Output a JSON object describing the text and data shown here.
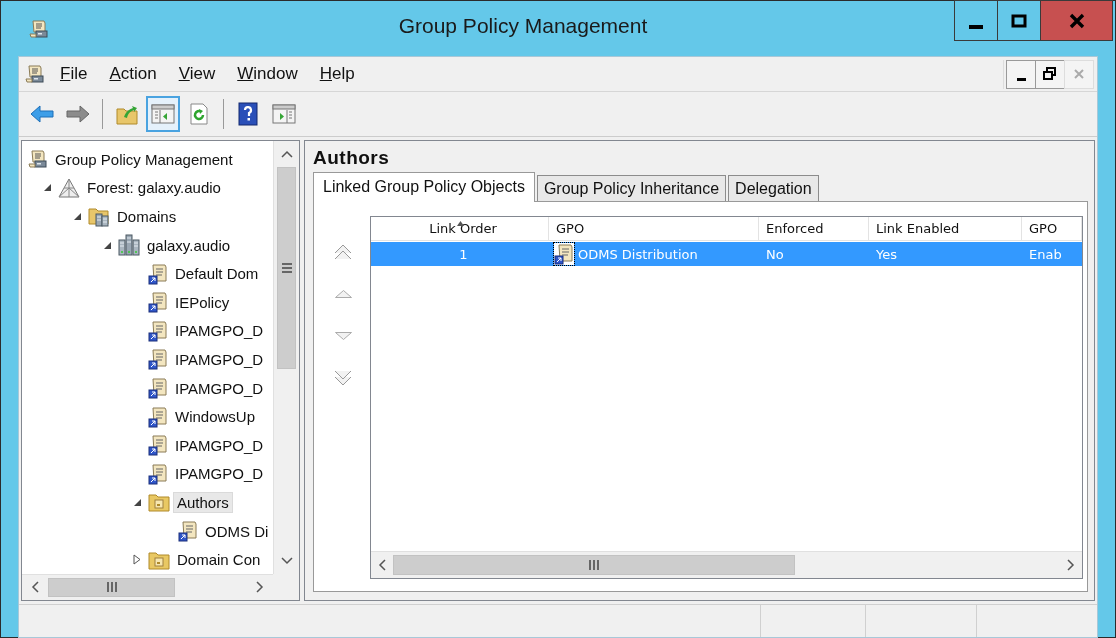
{
  "window": {
    "title": "Group Policy Management"
  },
  "menu": [
    "File",
    "Action",
    "View",
    "Window",
    "Help"
  ],
  "toolbar": {
    "buttons": [
      {
        "pressed": false
      },
      {
        "pressed": false
      },
      {
        "pressed": false
      },
      {
        "pressed": true
      },
      {
        "pressed": false
      },
      {
        "pressed": false
      },
      {
        "pressed": false
      }
    ]
  },
  "tree": {
    "items": [
      {
        "label": "Group Policy Management",
        "kind": "root",
        "selected": false,
        "children": [
          {
            "label": "Forest: galaxy.audio",
            "kind": "forest",
            "expanded": true,
            "selected": false,
            "children": [
              {
                "label": "Domains",
                "kind": "domains",
                "expanded": true,
                "selected": false,
                "children": [
                  {
                    "label": "galaxy.audio",
                    "kind": "domain",
                    "expanded": true,
                    "selected": false,
                    "children": [
                      {
                        "label": "Default Dom",
                        "kind": "gpo-link",
                        "selected": false
                      },
                      {
                        "label": "IEPolicy",
                        "kind": "gpo-link",
                        "selected": false
                      },
                      {
                        "label": "IPAMGPO_D",
                        "kind": "gpo-link",
                        "selected": false
                      },
                      {
                        "label": "IPAMGPO_D",
                        "kind": "gpo-link",
                        "selected": false
                      },
                      {
                        "label": "IPAMGPO_D",
                        "kind": "gpo-link",
                        "selected": false
                      },
                      {
                        "label": "WindowsUp",
                        "kind": "gpo-link",
                        "selected": false
                      },
                      {
                        "label": "IPAMGPO_D",
                        "kind": "gpo-link",
                        "selected": false
                      },
                      {
                        "label": "IPAMGPO_D",
                        "kind": "gpo-link",
                        "selected": false
                      },
                      {
                        "label": "Authors",
                        "kind": "ou",
                        "expanded": true,
                        "selected": true,
                        "children": [
                          {
                            "label": "ODMS Di",
                            "kind": "gpo-link",
                            "selected": false
                          }
                        ]
                      },
                      {
                        "label": "Domain Con",
                        "kind": "ou",
                        "expanded": false,
                        "selected": false
                      }
                    ]
                  }
                ]
              }
            ]
          }
        ]
      }
    ]
  },
  "details": {
    "heading": "Authors",
    "tabs": [
      {
        "label": "Linked Group Policy Objects",
        "selected": true
      },
      {
        "label": "Group Policy Inheritance",
        "selected": false
      },
      {
        "label": "Delegation",
        "selected": false
      }
    ],
    "table": {
      "columns": [
        {
          "label": "Link Order",
          "sorted": true
        },
        {
          "label": "GPO",
          "sorted": false
        },
        {
          "label": "Enforced",
          "sorted": false
        },
        {
          "label": "Link Enabled",
          "sorted": false
        },
        {
          "label": "GPO",
          "sorted": false
        }
      ],
      "rows": [
        {
          "cells": [
            "1",
            "ODMS Distribution",
            "No",
            "Yes",
            "Enab"
          ],
          "selected": true
        }
      ]
    }
  }
}
